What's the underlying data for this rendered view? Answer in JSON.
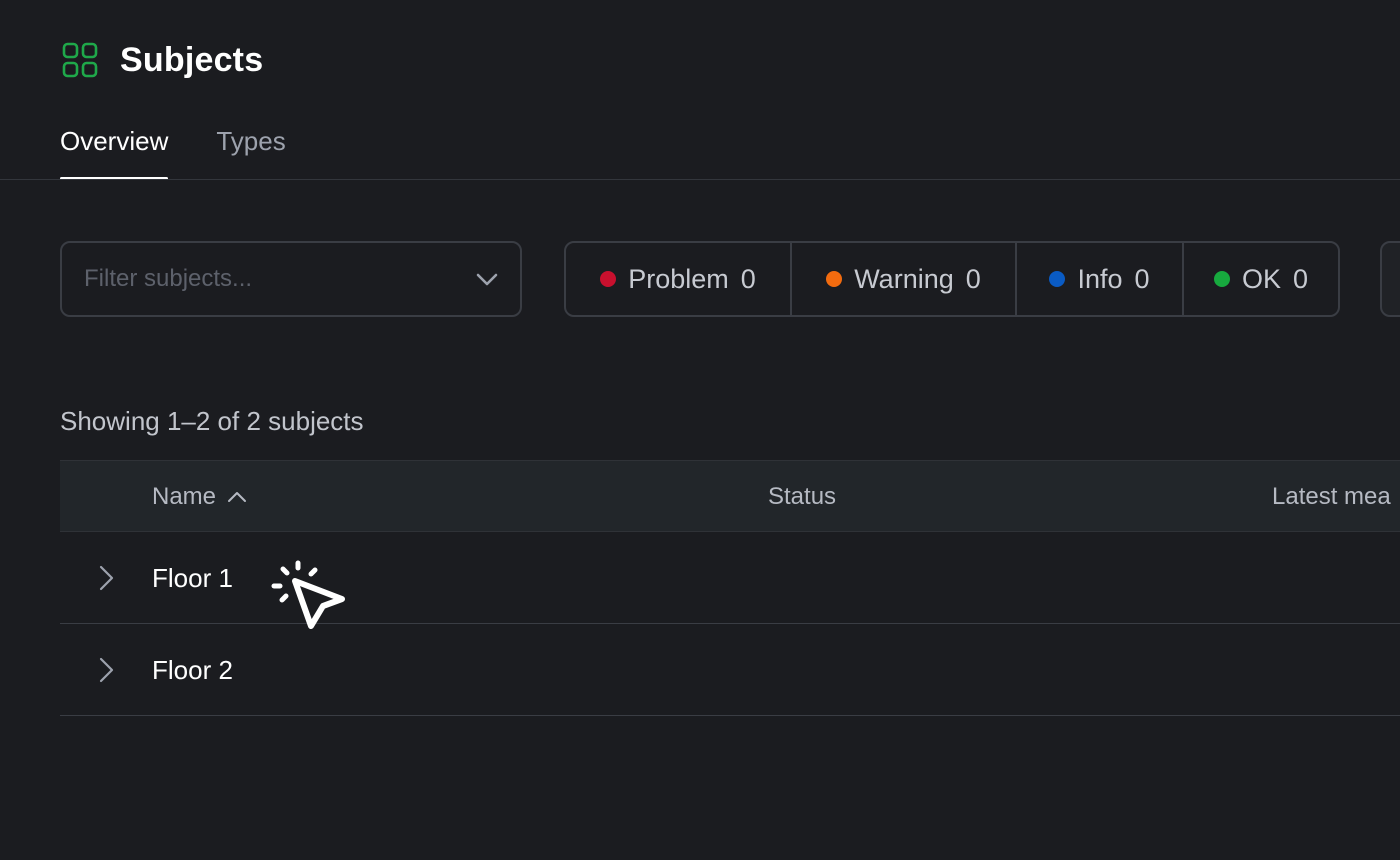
{
  "header": {
    "title": "Subjects",
    "icon": "grid-icon",
    "icon_color": "#1fa84a"
  },
  "tabs": [
    {
      "label": "Overview",
      "active": true
    },
    {
      "label": "Types",
      "active": false
    }
  ],
  "filter": {
    "placeholder": "Filter subjects...",
    "value": "",
    "icon": "chevron-down-icon"
  },
  "status_filters": [
    {
      "label": "Problem",
      "count": "0",
      "color": "#c8102e"
    },
    {
      "label": "Warning",
      "count": "0",
      "color": "#f26b0f"
    },
    {
      "label": "Info",
      "count": "0",
      "color": "#0a5bc4"
    },
    {
      "label": "OK",
      "count": "0",
      "color": "#17a93e"
    }
  ],
  "summary": "Showing 1–2 of 2 subjects",
  "table": {
    "columns": {
      "name": "Name",
      "status": "Status",
      "latest": "Latest mea"
    },
    "sort": {
      "column": "name",
      "direction": "ascending",
      "icon": "chevron-up-icon"
    },
    "rows": [
      {
        "name": "Floor 1",
        "expanded": false
      },
      {
        "name": "Floor 2",
        "expanded": false
      }
    ]
  },
  "colors": {
    "background": "#1b1c20",
    "header_row": "#22262a",
    "border": "#3a3d44",
    "accent": "#1fa84a"
  }
}
